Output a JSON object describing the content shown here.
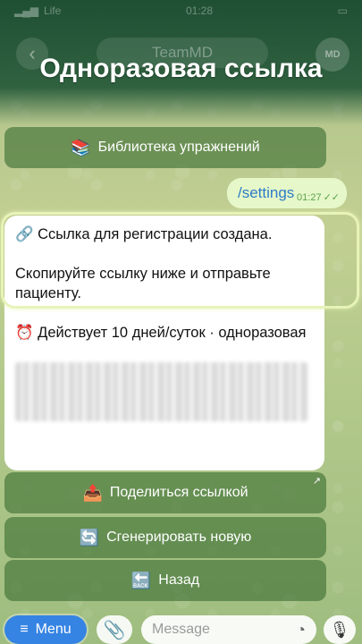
{
  "status_bar": {
    "carrier": "Life",
    "time": "01:28"
  },
  "header": {
    "back_icon": "chevron-left-icon",
    "chat_title": "TeamMD",
    "avatar_text": "MD",
    "overlay_title": "Одноразовая ссылка"
  },
  "messages": {
    "library_button": {
      "icon": "📚",
      "label": "Библиотека упражнений"
    },
    "outgoing": {
      "text": "/settings",
      "time": "01:27",
      "status_icon": "double-check-icon"
    },
    "card": {
      "line1_icon": "🔗",
      "line1": "Ссылка для регистрации создана.",
      "line2": "Скопируйте ссылку ниже и отправьте пациенту.",
      "line3_icon": "⏰",
      "line3": "Действует 10 дней/суток · одноразовая"
    }
  },
  "keyboard": [
    {
      "icon": "📤",
      "label": "Поделиться ссылкой",
      "corner": "↗"
    },
    {
      "icon": "🔄",
      "label": "Сгенерировать новую"
    },
    {
      "icon": "🔙",
      "label": "Назад"
    }
  ],
  "input_bar": {
    "menu_icon": "≡",
    "menu_label": "Menu",
    "attach_icon": "paperclip-icon",
    "placeholder": "Message",
    "sticker_icon": "sticker-icon",
    "mic_icon": "microphone-icon"
  },
  "colors": {
    "accent": "#3584e4",
    "outgoing_bubble": "#e6f8c9",
    "keyboard_button": "#4c7d3f",
    "highlight_border": "#e7f3b9"
  }
}
